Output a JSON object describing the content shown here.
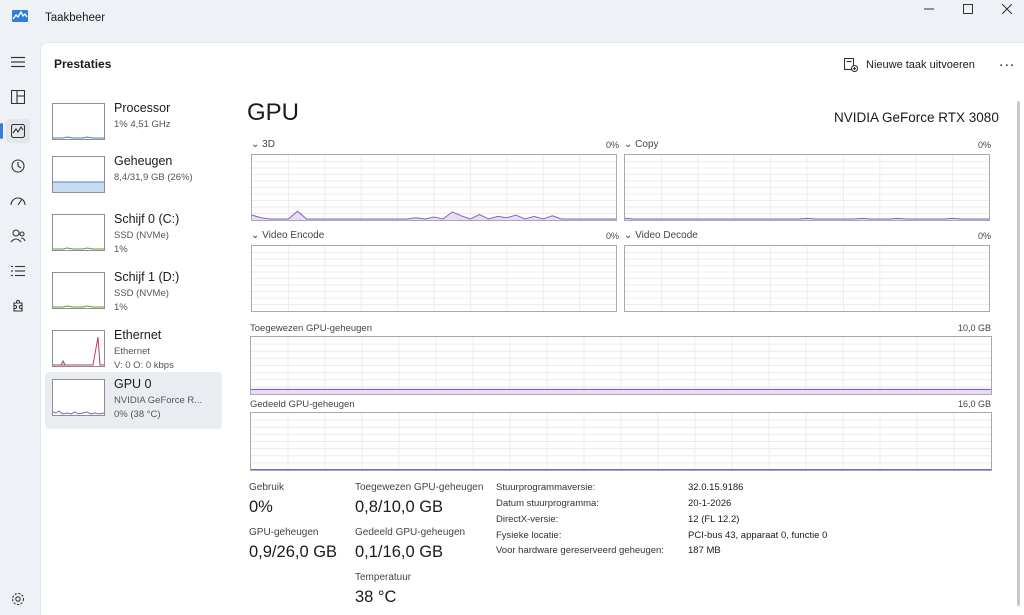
{
  "window": {
    "title": "Taakbeheer"
  },
  "nav": {
    "items": [
      "menu",
      "processes",
      "performance",
      "app-history",
      "startup",
      "users",
      "details",
      "services"
    ],
    "active": "performance"
  },
  "header": {
    "title": "Prestaties",
    "new_task": "Nieuwe taak uitvoeren",
    "more": "..."
  },
  "devices": [
    {
      "name": "Processor",
      "line1": "1% 4,51 GHz",
      "line2": "",
      "kind": "cpu"
    },
    {
      "name": "Geheugen",
      "line1": "8,4/31,9 GB (26%)",
      "line2": "",
      "kind": "memory"
    },
    {
      "name": "Schijf 0 (C:)",
      "line1": "SSD (NVMe)",
      "line2": "1%",
      "kind": "disk"
    },
    {
      "name": "Schijf 1 (D:)",
      "line1": "SSD (NVMe)",
      "line2": "1%",
      "kind": "disk"
    },
    {
      "name": "Ethernet",
      "line1": "Ethernet",
      "line2": "V: 0 O: 0 kbps",
      "kind": "ethernet"
    },
    {
      "name": "GPU 0",
      "line1": "NVIDIA GeForce R...",
      "line2": "0% (38 °C)",
      "kind": "gpu",
      "active": true
    }
  ],
  "gpu": {
    "title": "GPU",
    "model": "NVIDIA GeForce RTX 3080",
    "engines": [
      {
        "label": "3D",
        "pct": "0%",
        "series": [
          0.06,
          0.02,
          0,
          0,
          0,
          0.12,
          0,
          0,
          0,
          0,
          0,
          0,
          0,
          0,
          0,
          0,
          0,
          0,
          0.02,
          0,
          0.03,
          0,
          0.11,
          0.05,
          0,
          0.07,
          0,
          0.04,
          0.02,
          0.06,
          0,
          0.04,
          0,
          0.05,
          0,
          0,
          0,
          0,
          0,
          0,
          0
        ]
      },
      {
        "label": "Copy",
        "pct": "0%",
        "series": [
          0.01,
          0,
          0,
          0,
          0,
          0,
          0,
          0,
          0,
          0,
          0,
          0,
          0,
          0,
          0,
          0,
          0,
          0,
          0,
          0,
          0.01,
          0,
          0,
          0,
          0,
          0,
          0.01,
          0,
          0,
          0,
          0.01,
          0,
          0,
          0,
          0,
          0,
          0.01,
          0,
          0,
          0,
          0
        ]
      },
      {
        "label": "Video Encode",
        "pct": "0%",
        "series": []
      },
      {
        "label": "Video Decode",
        "pct": "0%",
        "series": []
      }
    ],
    "dedicated": {
      "label": "Toegewezen GPU-geheugen",
      "max": "10,0 GB",
      "fill": 0.08
    },
    "shared": {
      "label": "Gedeeld GPU-geheugen",
      "max": "16,0 GB",
      "fill": 0.006
    },
    "stats": {
      "usage_label": "Gebruik",
      "usage_value": "0%",
      "gpumem_label": "GPU-geheugen",
      "gpumem_value": "0,9/26,0 GB",
      "dedicated_label": "Toegewezen GPU-geheugen",
      "dedicated_value": "0,8/10,0 GB",
      "shared_label": "Gedeeld GPU-geheugen",
      "shared_value": "0,1/16,0 GB",
      "temp_label": "Temperatuur",
      "temp_value": "38 °C"
    },
    "properties": [
      {
        "key": "Stuurprogrammaversie:",
        "value": "32.0.15.9186"
      },
      {
        "key": "Datum stuurprogramma:",
        "value": "20-1-2026"
      },
      {
        "key": "DirectX-versie:",
        "value": "12 (FL 12.2)"
      },
      {
        "key": "Fysieke locatie:",
        "value": "PCI-bus 43, apparaat 0, functie 0"
      },
      {
        "key": "Voor hardware gereserveerd geheugen:",
        "value": "187 MB"
      }
    ]
  },
  "colors": {
    "cpu": "#3d83c4",
    "memory": "#3d83c4",
    "disk": "#5c9e34",
    "ethernet": "#c0396e",
    "gpu": "#8661c5",
    "gpu_fill": "#e7def5"
  }
}
